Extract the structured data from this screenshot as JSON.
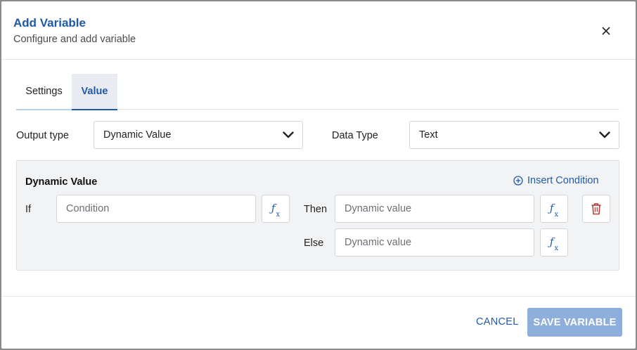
{
  "dialog": {
    "title": "Add Variable",
    "subtitle": "Configure and add variable"
  },
  "tabs": [
    {
      "label": "Settings",
      "active": false
    },
    {
      "label": "Value",
      "active": true
    }
  ],
  "form": {
    "output_type_label": "Output type",
    "output_type_value": "Dynamic Value",
    "data_type_label": "Data Type",
    "data_type_value": "Text"
  },
  "dynamic_panel": {
    "title": "Dynamic Value",
    "insert_condition": "Insert Condition",
    "if_label": "If",
    "then_label": "Then",
    "else_label": "Else",
    "condition_placeholder": "Condition",
    "then_placeholder": "Dynamic value",
    "else_placeholder": "Dynamic value"
  },
  "footer": {
    "cancel_label": "CANCEL",
    "save_label": "SAVE VARIABLE"
  },
  "colors": {
    "accent": "#1f5aa8",
    "save_disabled": "#8eaedb",
    "delete": "#b0413e"
  }
}
